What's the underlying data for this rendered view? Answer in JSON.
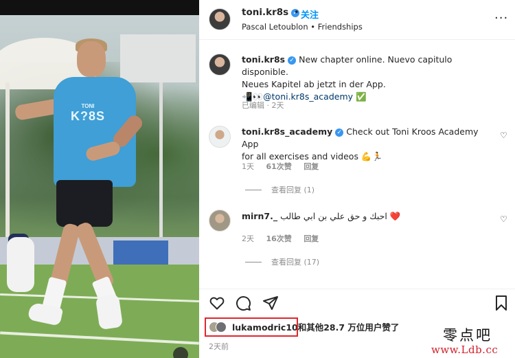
{
  "header": {
    "username": "toni.kr8s",
    "follow_label": "关注",
    "subtitle": "Pascal Letoublon • Friendships",
    "more_icon": "more-horizontal-icon"
  },
  "post": {
    "username": "toni.kr8s",
    "caption_line1": "New chapter online. Nuevo capitulo disponible.",
    "caption_line2": "Neues Kapitel ab jetzt in der App.",
    "caption_emoji": "📲👀",
    "mention": "@toni.kr8s_academy",
    "check_emoji": "✅",
    "edited": "已编辑 · 2天"
  },
  "comments": [
    {
      "username": "toni.kr8s_academy",
      "text_inline": "Check out Toni Kroos Academy App",
      "text_line2": "for all exercises and videos 💪🏃",
      "time": "1天",
      "likes": "61次赞",
      "reply_label": "回复",
      "view_replies": "查看回复 (1)"
    },
    {
      "username": "mirn7._",
      "text_inline": "احبك و حق علي بن ابي طالب",
      "text_emoji": "❤️",
      "time": "2天",
      "likes": "16次赞",
      "reply_label": "回复",
      "view_replies": "查看回复 (17)"
    }
  ],
  "likes": {
    "liker": "lukamodric10",
    "rest": "和其他28.7 万位用户赞了"
  },
  "date": "2天前",
  "photo": {
    "shirt_text": "K?8S",
    "shirt_small": "TONI"
  },
  "watermark": {
    "line1": "零点吧",
    "line2": "www.Ldb.cc"
  },
  "colors": {
    "link": "#00376b",
    "follow": "#0095f6",
    "highlight_box": "#e0262e",
    "watermark_red": "#d0202a"
  }
}
